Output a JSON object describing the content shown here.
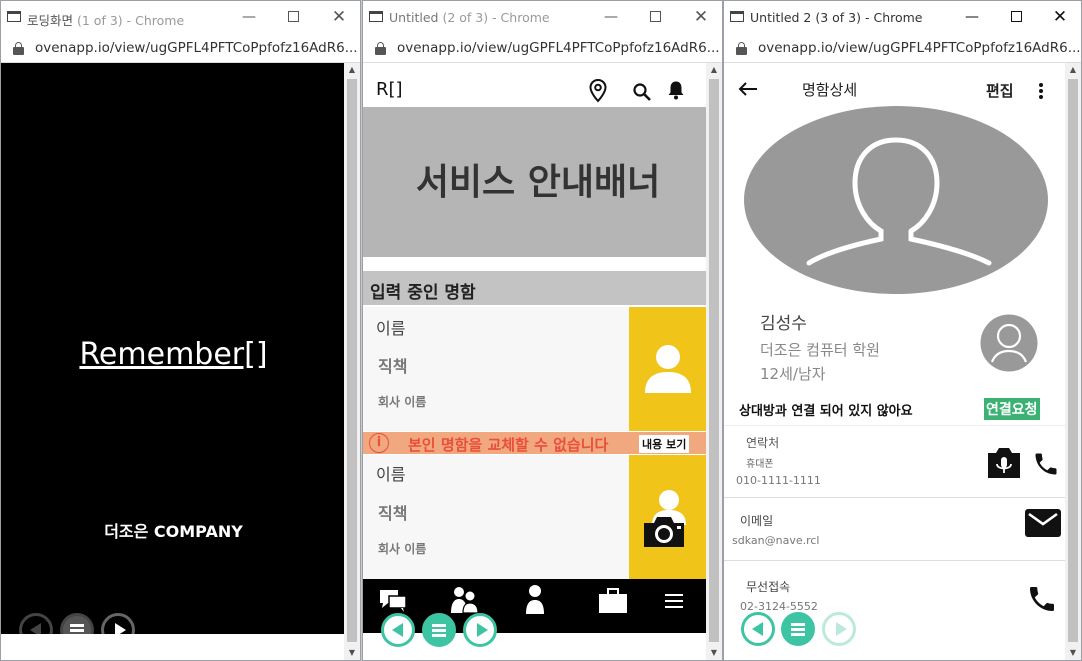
{
  "windows": [
    {
      "title": "로딩화면",
      "title_suffix": "(1 of 3) - Chrome",
      "url": "ovenapp.io/view/ugGPFL4PFTCoPpfofz16AdR6..."
    },
    {
      "title": "Untitled",
      "title_suffix": "(2 of 3) - Chrome",
      "url": "ovenapp.io/view/ugGPFL4PFTCoPpfofz16AdR6..."
    },
    {
      "title": "Untitled 2",
      "title_suffix": "(3 of 3) - Chrome",
      "url": "ovenapp.io/view/ugGPFL4PFTCoPpfofz16AdR6..."
    }
  ],
  "loading": {
    "logo_text": "Remember[]",
    "company": "더조은 COMPANY"
  },
  "home": {
    "logo": "R[]",
    "banner": "서비스 안내배너",
    "section_title": "입력 중인 명함",
    "card1": {
      "name": "이름",
      "position": "직책",
      "company": "회사 이름"
    },
    "warning": "본인 명함을 교체할 수 없습니다",
    "view_button": "내용 보기",
    "card2": {
      "name": "이름",
      "position": "직책",
      "company": "회사 이름"
    }
  },
  "detail": {
    "header_title": "명함상세",
    "edit_label": "편집",
    "name": "김성수",
    "org": "더조은 컴퓨터 학원",
    "age_gender": "12세/남자",
    "connect_status": "상대방과 연결 되어 있지 않아요",
    "connect_button": "연결요청",
    "contact_label": "연락처",
    "contact_sub": "휴대폰",
    "contact_number": "010-1111-1111",
    "email_label": "이메일",
    "email_value": "sdkan@nave.rcl",
    "wireless_label": "무선접속",
    "wireless_number": "02-3124-5552"
  },
  "colors": {
    "accent_teal": "#3dc5a3",
    "card_yellow": "#f0c419",
    "warning_red": "#e8503a",
    "connect_green": "#3bb273",
    "banner_gray": "#b5b5b5"
  }
}
